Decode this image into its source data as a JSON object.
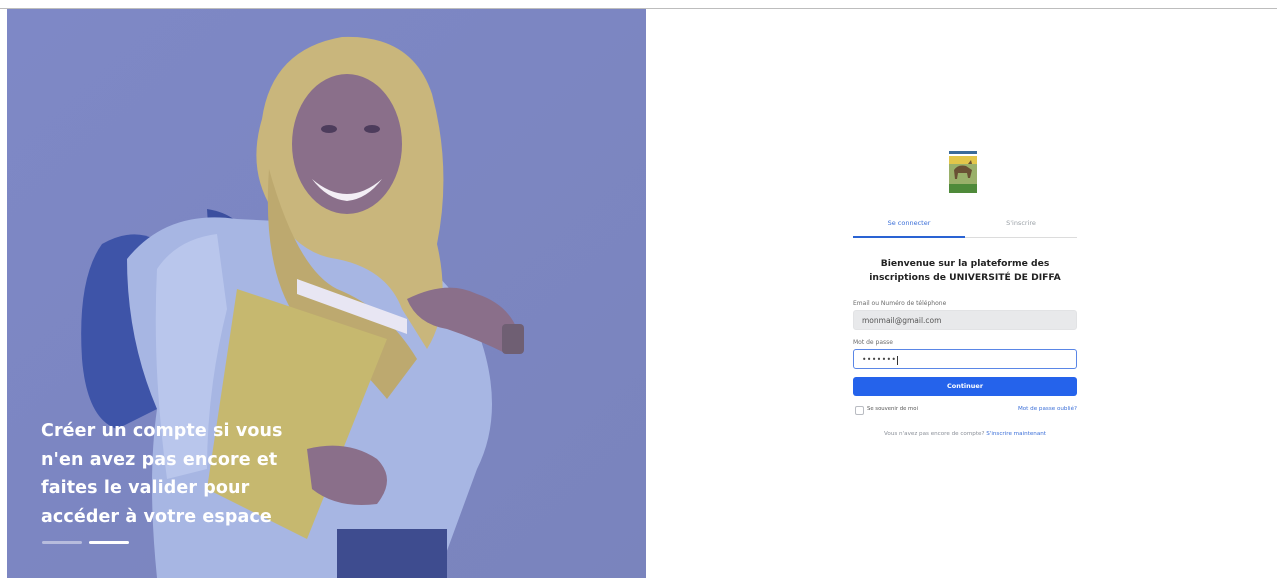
{
  "hero": {
    "tagline_lines": [
      "Créer un compte si vous",
      "n'en avez pas encore et",
      "faites le valider pour",
      "accéder à votre espace"
    ],
    "overlay_color": "#7f89c4",
    "carousel": {
      "slides": 2,
      "active": 2
    }
  },
  "login": {
    "logo_icon": "university-logo-icon",
    "tabs": [
      {
        "label": "Se connecter",
        "active": true
      },
      {
        "label": "S'inscrire",
        "active": false
      }
    ],
    "welcome_lines": [
      "Bienvenue sur la plateforme des",
      "inscriptions de UNIVERSITÉ DE DIFFA"
    ],
    "email": {
      "label": "Email ou Numéro de téléphone",
      "value": "monmail@gmail.com"
    },
    "password": {
      "label": "Mot de passe",
      "value": "•••••••"
    },
    "continue_label": "Continuer",
    "remember_label": "Se souvenir de moi",
    "forgot_label": "Mot de passe oublié?",
    "signup_prompt": "Vous n'avez pas encore de compte?",
    "signup_link": "S'inscrire maintenant",
    "accent_color": "#2563eb"
  }
}
